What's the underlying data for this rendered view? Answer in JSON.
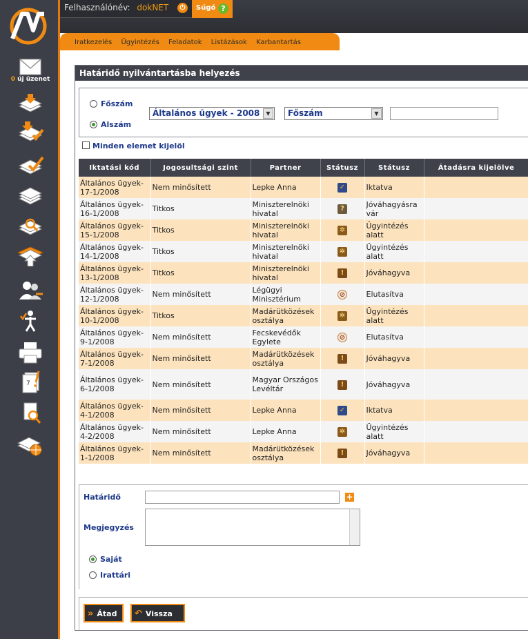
{
  "header": {
    "user_label": "Felhasználónév:",
    "username": "dokNET",
    "help_label": "Súgó"
  },
  "sidebar": {
    "message_count": "0",
    "message_label": "új üzenet",
    "icons": [
      "envelope-icon",
      "inbox-stack-icon",
      "inbox-check-icon",
      "docs-check-icon",
      "docs-stack-icon",
      "docs-search-icon",
      "docs-upload-icon",
      "users-icon",
      "person-task-icon",
      "printer-icon",
      "calendar-icon",
      "document-search-icon",
      "docs-globe-icon"
    ]
  },
  "nav": {
    "items": [
      "Iratkezelés",
      "Ügyintézés",
      "Feladatok",
      "Listázások",
      "Karbantartás"
    ]
  },
  "panel": {
    "title": "Határidő nyilvántartásba helyezés"
  },
  "filter": {
    "radio_main": "Főszám",
    "radio_sub": "Alszám",
    "category_value": "Általános ügyek - 2008",
    "number_type_value": "Főszám",
    "search_value": "",
    "select_all_label": "Minden elemet kijelöl"
  },
  "table": {
    "headers": [
      "Iktatási kód",
      "Jogosultsági szint",
      "Partner",
      "Státusz",
      "Státusz",
      "Átadásra kijelölve"
    ],
    "rows": [
      {
        "code": "Általános ügyek-17-1/2008",
        "level": "Nem minősített",
        "partner": "Lepke Anna",
        "icon": "check",
        "status": "Iktatva"
      },
      {
        "code": "Általános ügyek-16-1/2008",
        "level": "Titkos",
        "partner": "Miniszterelnöki hivatal",
        "icon": "question",
        "status": "Jóváhagyásra vár"
      },
      {
        "code": "Általános ügyek-15-1/2008",
        "level": "Titkos",
        "partner": "Miniszterelnöki hivatal",
        "icon": "gear",
        "status": "Ügyintézés alatt"
      },
      {
        "code": "Általános ügyek-14-1/2008",
        "level": "Titkos",
        "partner": "Miniszterelnöki hivatal",
        "icon": "gear",
        "status": "Ügyintézés alatt"
      },
      {
        "code": "Általános ügyek-13-1/2008",
        "level": "Titkos",
        "partner": "Miniszterelnöki hivatal",
        "icon": "exclamation",
        "status": "Jóváhagyva"
      },
      {
        "code": "Általános ügyek-12-1/2008",
        "level": "Nem minősített",
        "partner": "Légügyi Minisztérium",
        "icon": "no",
        "status": "Elutasítva"
      },
      {
        "code": "Általános ügyek-10-1/2008",
        "level": "Titkos",
        "partner": "Madárütközések osztálya",
        "icon": "gear",
        "status": "Ügyintézés alatt"
      },
      {
        "code": "Általános ügyek-9-1/2008",
        "level": "Nem minősített",
        "partner": "Fecskevédők Egylete",
        "icon": "no",
        "status": "Elutasítva"
      },
      {
        "code": "Általános ügyek-7-1/2008",
        "level": "Nem minősített",
        "partner": "Madárütközések osztálya",
        "icon": "exclamation",
        "status": "Jóváhagyva"
      },
      {
        "code": "Általános ügyek-6-1/2008",
        "level": "Nem minősített",
        "partner": "Magyar Országos Levéltár",
        "icon": "exclamation",
        "status": "Jóváhagyva"
      },
      {
        "code": "Általános ügyek-4-1/2008",
        "level": "Nem minősített",
        "partner": "Lepke Anna",
        "icon": "check",
        "status": "Iktatva"
      },
      {
        "code": "Általános ügyek-4-2/2008",
        "level": "Nem minősített",
        "partner": "Lepke Anna",
        "icon": "gear",
        "status": "Ügyintézés alatt"
      },
      {
        "code": "Általános ügyek-1-1/2008",
        "level": "Nem minősített",
        "partner": "Madárütközések osztálya",
        "icon": "exclamation",
        "status": "Jóváhagyva"
      }
    ]
  },
  "form": {
    "deadline_label": "Határidő",
    "deadline_value": "",
    "comment_label": "Megjegyzés",
    "comment_value": "",
    "radio_own": "Saját",
    "radio_archive": "Irattári"
  },
  "buttons": {
    "submit_label": "Átad",
    "back_label": "Vissza"
  },
  "colors": {
    "accent": "#f08a12",
    "dark": "#3f424a",
    "row_odd": "#fde3bd",
    "row_even": "#f4f4f4",
    "link": "#1e3a8a"
  }
}
